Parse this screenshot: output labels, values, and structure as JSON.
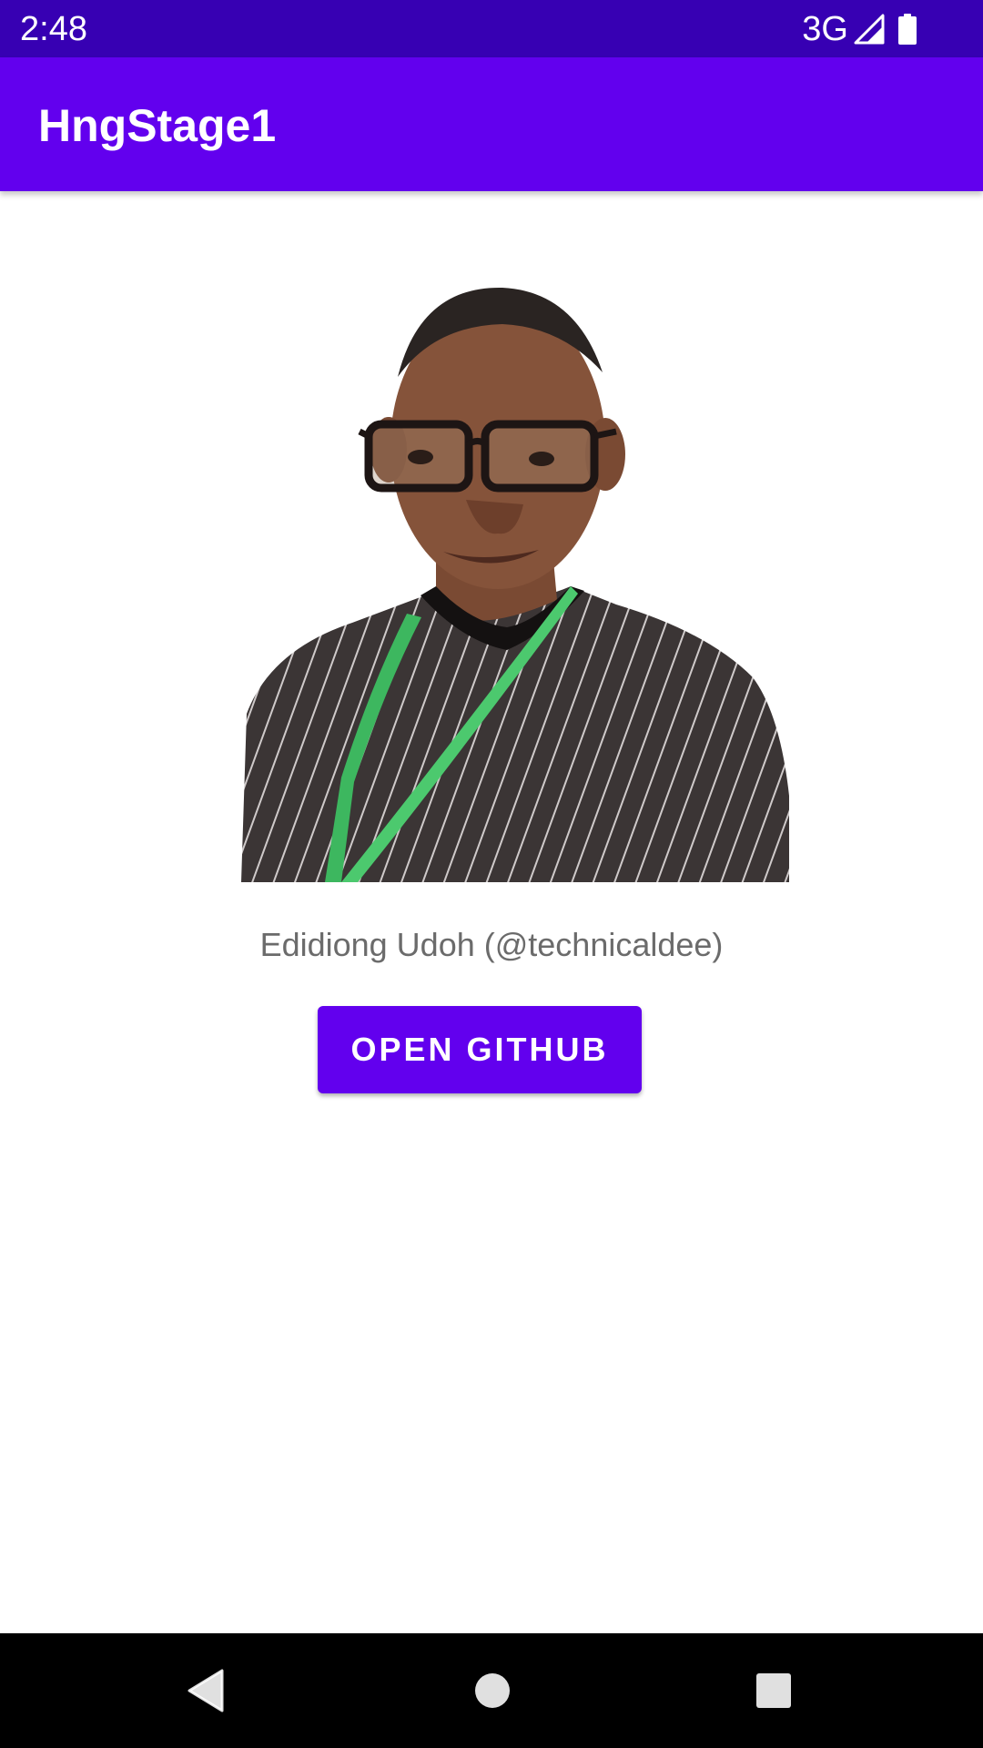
{
  "status_bar": {
    "time": "2:48",
    "network": "3G",
    "signal_icon": "cell-signal-icon",
    "battery_icon": "battery-icon",
    "background_color": "#3700b3"
  },
  "app_bar": {
    "title": "HngStage1",
    "background_color": "#6200ee"
  },
  "profile": {
    "photo": "profile-photo",
    "name": "Edidiong Udoh (@technicaldee)"
  },
  "actions": {
    "open_github_label": "OPEN GITHUB",
    "button_color": "#6200ee"
  },
  "nav_bar": {
    "back_icon": "back-triangle-icon",
    "home_icon": "home-circle-icon",
    "recents_icon": "recents-square-icon"
  }
}
